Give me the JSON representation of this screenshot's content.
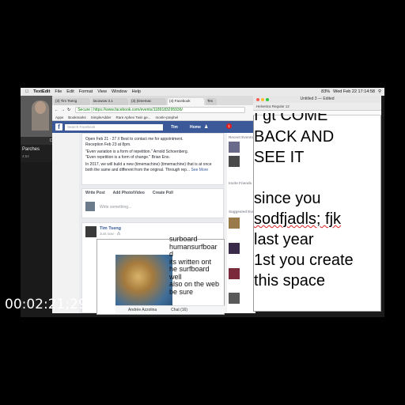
{
  "menubar": {
    "app": "TextEdit",
    "items": [
      "File",
      "Edit",
      "Format",
      "View",
      "Window",
      "Help"
    ],
    "datetime": "Wed Feb 22 17:14:58",
    "battery": "83%"
  },
  "facetime": {
    "bar_label": "Current Call",
    "caller": "Parches",
    "status": "4:54"
  },
  "browser": {
    "tabs": [
      "(3) Tim Tseng",
      "lacowow 3.1",
      "(3) (timemac",
      "(4) Facebook",
      "Tes"
    ],
    "url": "Secure | https://www.facebook.com/events/1189183295936/",
    "bookmarks": [
      "Apps",
      "Bookmarks",
      "SimpleAdder",
      "Rare Aphex Twin ge...",
      "monk+prephel"
    ]
  },
  "facebook": {
    "logo": "f",
    "search_placeholder": "Search Facebook",
    "user": "Tim",
    "home": "Home",
    "notif_count": "1",
    "event_lines": [
      "Open Feb 21 - 27 // Best to contact me for appointment.",
      "Reception Feb 23 at 8pm.",
      "\"Even variation is a form of repetition.\" Arnold Schoenberg.",
      "\"Even repetition is a form of change.\" Brian Eno.",
      "In 2017, we will build a new (timemachine) (timemachine) that is at once both the same and different from the original. Through rep..."
    ],
    "see_more": "See More",
    "composer": {
      "write_post": "Write Post",
      "add_photo": "Add Photo/Video",
      "create_poll": "Create Poll",
      "placeholder": "Write something..."
    },
    "post": {
      "author": "Tim Tseng",
      "time": "Just now · ⁂",
      "embedded_text": [
        "humansurfboar",
        "d",
        "its written ont",
        "he surfboard",
        "well",
        "also on the web",
        "be sure"
      ],
      "embedded_header": "surboard"
    },
    "chat_bar": {
      "left": "Andrée Azzolina",
      "right": "Chat (16)"
    },
    "right_rail": {
      "recent": "Recent Events",
      "invite": "Invite Friends",
      "suggested": "Suggested Events"
    }
  },
  "textedit": {
    "title": "Untitled 3 — Edited",
    "toolbar": "Helvetica   Regular   12",
    "partial_line": "I gt COME",
    "lines": [
      {
        "text": "BACK AND",
        "spell": false
      },
      {
        "text": "SEE IT",
        "spell": false
      },
      {
        "text": "",
        "spell": false
      },
      {
        "text": "since you",
        "spell": false
      },
      {
        "text": "sodfjadls; fjk",
        "spell": true
      },
      {
        "text": "last year",
        "spell": false
      },
      {
        "text": "1st you create",
        "spell": false
      },
      {
        "text": "this space",
        "spell": false
      }
    ]
  },
  "timecode": "00:02:21;29"
}
